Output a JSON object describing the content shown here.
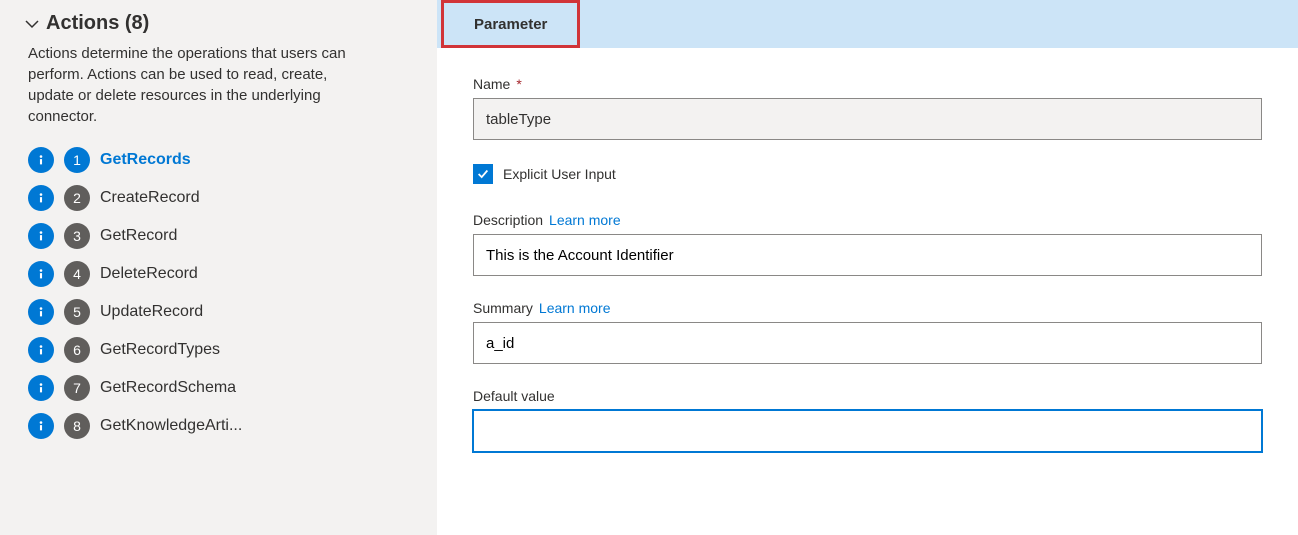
{
  "sidebar": {
    "header": "Actions (8)",
    "description": "Actions determine the operations that users can perform. Actions can be used to read, create, update or delete resources in the underlying connector.",
    "items": [
      {
        "num": "1",
        "label": "GetRecords",
        "selected": true
      },
      {
        "num": "2",
        "label": "CreateRecord",
        "selected": false
      },
      {
        "num": "3",
        "label": "GetRecord",
        "selected": false
      },
      {
        "num": "4",
        "label": "DeleteRecord",
        "selected": false
      },
      {
        "num": "5",
        "label": "UpdateRecord",
        "selected": false
      },
      {
        "num": "6",
        "label": "GetRecordTypes",
        "selected": false
      },
      {
        "num": "7",
        "label": "GetRecordSchema",
        "selected": false
      },
      {
        "num": "8",
        "label": "GetKnowledgeArti...",
        "selected": false
      }
    ]
  },
  "main": {
    "tab": "Parameter",
    "form": {
      "name_label": "Name",
      "name_required": "*",
      "name_value": "tableType",
      "explicit_label": "Explicit User Input",
      "explicit_checked": true,
      "description_label": "Description",
      "learn_more": "Learn more",
      "description_value": "This is the Account Identifier",
      "summary_label": "Summary",
      "summary_value": "a_id",
      "default_label": "Default value",
      "default_value": ""
    }
  }
}
